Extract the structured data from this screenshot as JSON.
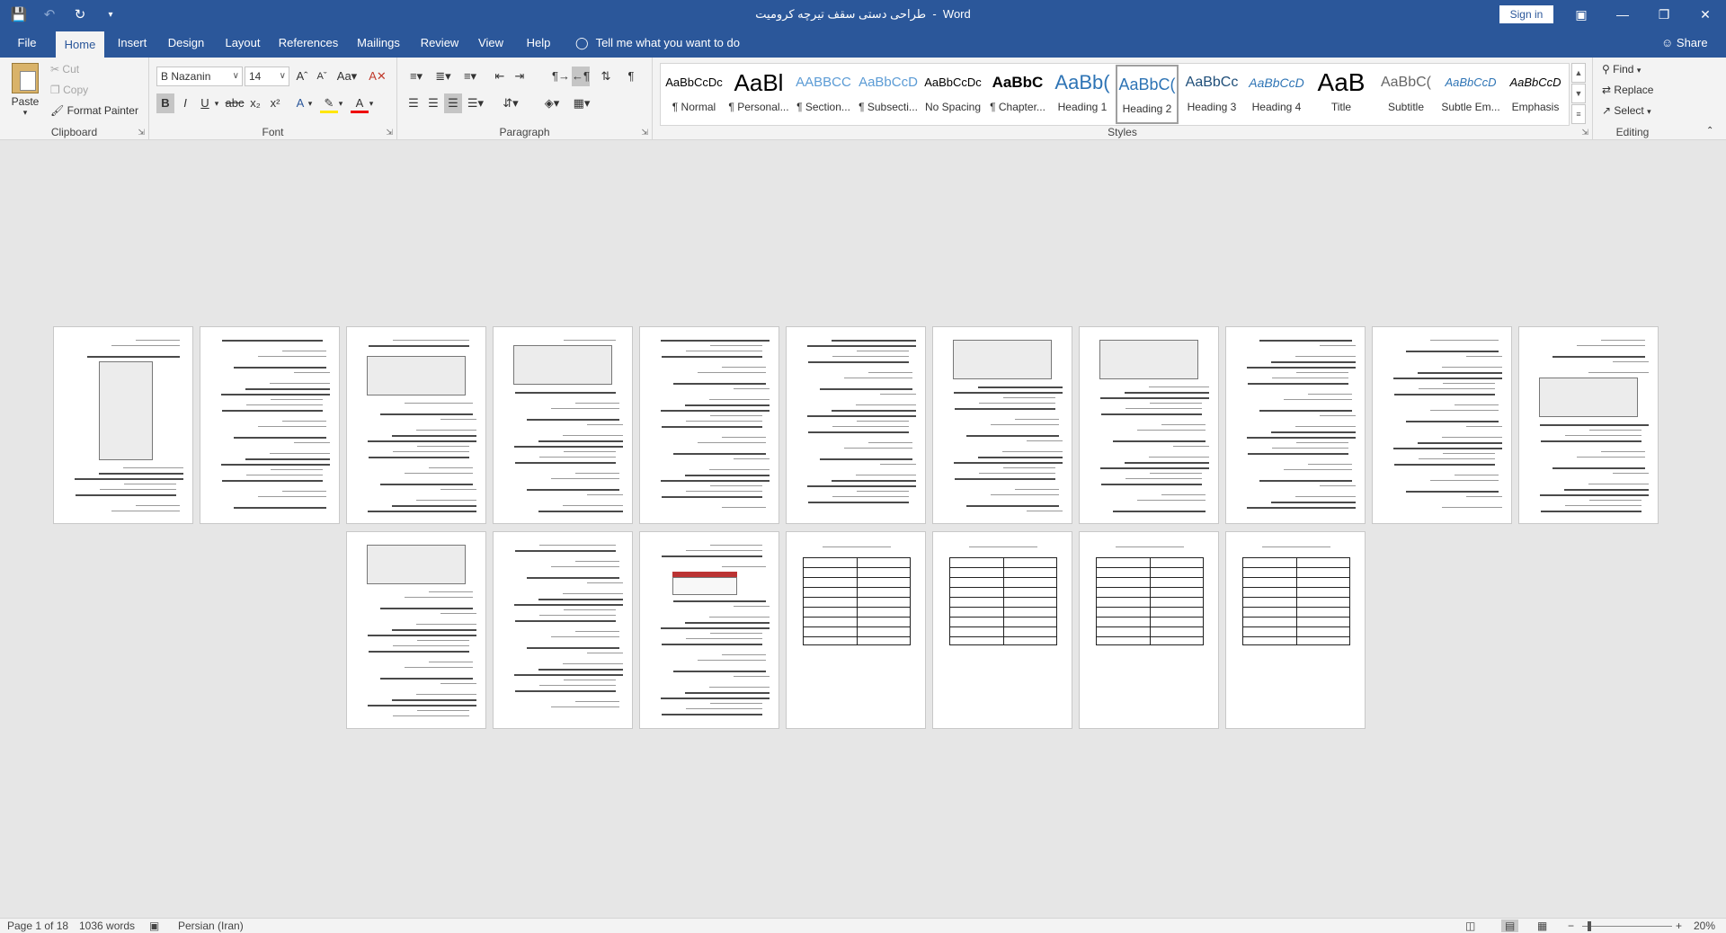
{
  "titlebar": {
    "document_title": "طراحی دستی سقف تیرچه کرومیت",
    "app_name": "Word",
    "separator": "-",
    "sign_in": "Sign in",
    "qat": {
      "save_icon": "save-icon",
      "undo_icon": "undo-icon",
      "redo_icon": "redo-icon",
      "customize_icon": "chevron-down-icon"
    }
  },
  "tabs": [
    "File",
    "Home",
    "Insert",
    "Design",
    "Layout",
    "References",
    "Mailings",
    "Review",
    "View",
    "Help"
  ],
  "active_tab": "Home",
  "tell_me": "Tell me what you want to do",
  "share": "Share",
  "clipboard": {
    "label": "Clipboard",
    "paste": "Paste",
    "cut": "Cut",
    "copy": "Copy",
    "format_painter": "Format Painter"
  },
  "font": {
    "label": "Font",
    "name": "B Nazanin",
    "size": "14"
  },
  "paragraph": {
    "label": "Paragraph"
  },
  "styles": {
    "label": "Styles",
    "items": [
      {
        "preview": "AaBbCcDc",
        "name": "¶ Normal"
      },
      {
        "preview": "AaBl",
        "name": "¶ Personal..."
      },
      {
        "preview": "AABBCC",
        "name": "¶ Section..."
      },
      {
        "preview": "AaBbCcD",
        "name": "¶ Subsecti..."
      },
      {
        "preview": "AaBbCcDc",
        "name": "No Spacing"
      },
      {
        "preview": "AaBbC",
        "name": "¶ Chapter..."
      },
      {
        "preview": "AaBb(",
        "name": "Heading 1"
      },
      {
        "preview": "AaBbC(",
        "name": "Heading 2"
      },
      {
        "preview": "AaBbCc",
        "name": "Heading 3"
      },
      {
        "preview": "AaBbCcD",
        "name": "Heading 4"
      },
      {
        "preview": "AaB",
        "name": "Title"
      },
      {
        "preview": "AaBbC(",
        "name": "Subtitle"
      },
      {
        "preview": "AaBbCcD",
        "name": "Subtle Em..."
      },
      {
        "preview": "AaBbCcD",
        "name": "Emphasis"
      }
    ],
    "selected": "Heading 2"
  },
  "editing": {
    "label": "Editing",
    "find": "Find",
    "replace": "Replace",
    "select": "Select"
  },
  "status": {
    "page": "Page 1 of 18",
    "words": "1036 words",
    "language": "Persian (Iran)",
    "zoom": "20%"
  },
  "document": {
    "page_count": 18,
    "pages_per_row": 11
  },
  "colors": {
    "brand": "#2b579a",
    "ribbon": "#f3f3f3",
    "canvas": "#e6e6e6"
  }
}
